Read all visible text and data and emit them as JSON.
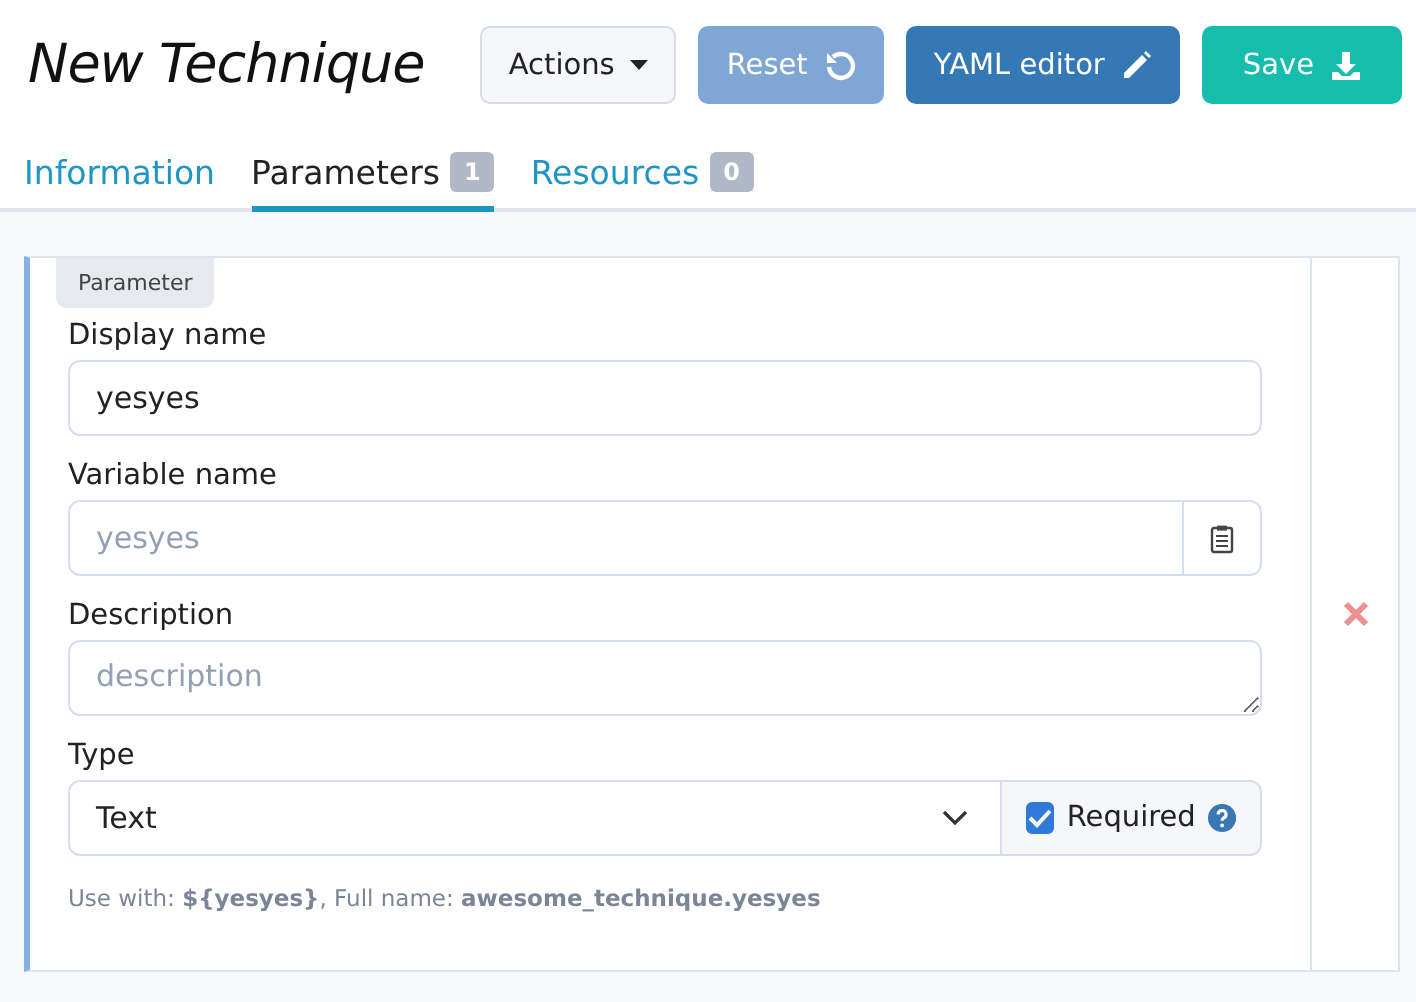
{
  "title": "New Technique",
  "actions": [
    {
      "kind": "dropdown",
      "label": "Actions",
      "disabled": false
    },
    {
      "kind": "reset",
      "label": "Reset",
      "disabled": true
    },
    {
      "kind": "edit",
      "label": "YAML editor",
      "disabled": false
    },
    {
      "kind": "save",
      "label": "Save",
      "disabled": false
    }
  ],
  "tabs": [
    {
      "label": "Information",
      "selected": false
    },
    {
      "label": "Parameters",
      "count": "1",
      "selected": true
    },
    {
      "label": "Resources",
      "count": "0",
      "selected": false
    }
  ],
  "parameter": {
    "tag": "Parameter",
    "display_name": {
      "label": "Display name",
      "value": "yesyes"
    },
    "variable_name": {
      "label": "Variable name",
      "placeholder": "yesyes"
    },
    "description": {
      "label": "Description",
      "placeholder": "description"
    },
    "type": {
      "label": "Type",
      "value": "Text",
      "required_label": "Required",
      "required": true
    },
    "usage": "Use with:  **${yesyes}**, Full name:  **awesome_technique.yesyes**"
  }
}
